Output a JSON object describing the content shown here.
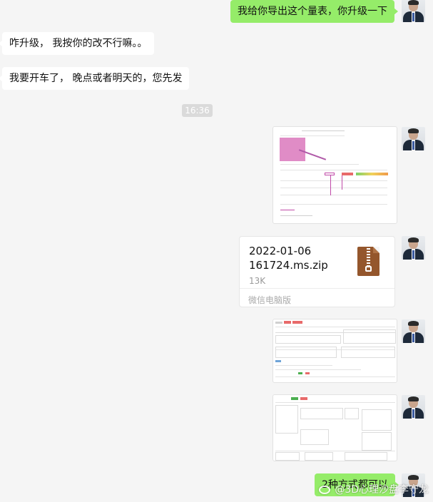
{
  "messages": {
    "m1": "我给你导出这个量表，你升级一下",
    "m2": "咋升级， 我按你的改不行嘛。。",
    "m3": "我要开车了， 晚点或者明天的，您先发",
    "timestamp": "16:36",
    "last": "2种方式都可以"
  },
  "file": {
    "name_line1": "2022-01-06",
    "name_line2": "161724.ms.zip",
    "size": "13K",
    "source": "微信电脑版",
    "icon": "zip-file-icon"
  },
  "watermark": "@3D心理沙盘李守龙",
  "colors": {
    "sent_bubble": "#95ec69",
    "received_bubble": "#ffffff",
    "background": "#f5f5f5"
  }
}
